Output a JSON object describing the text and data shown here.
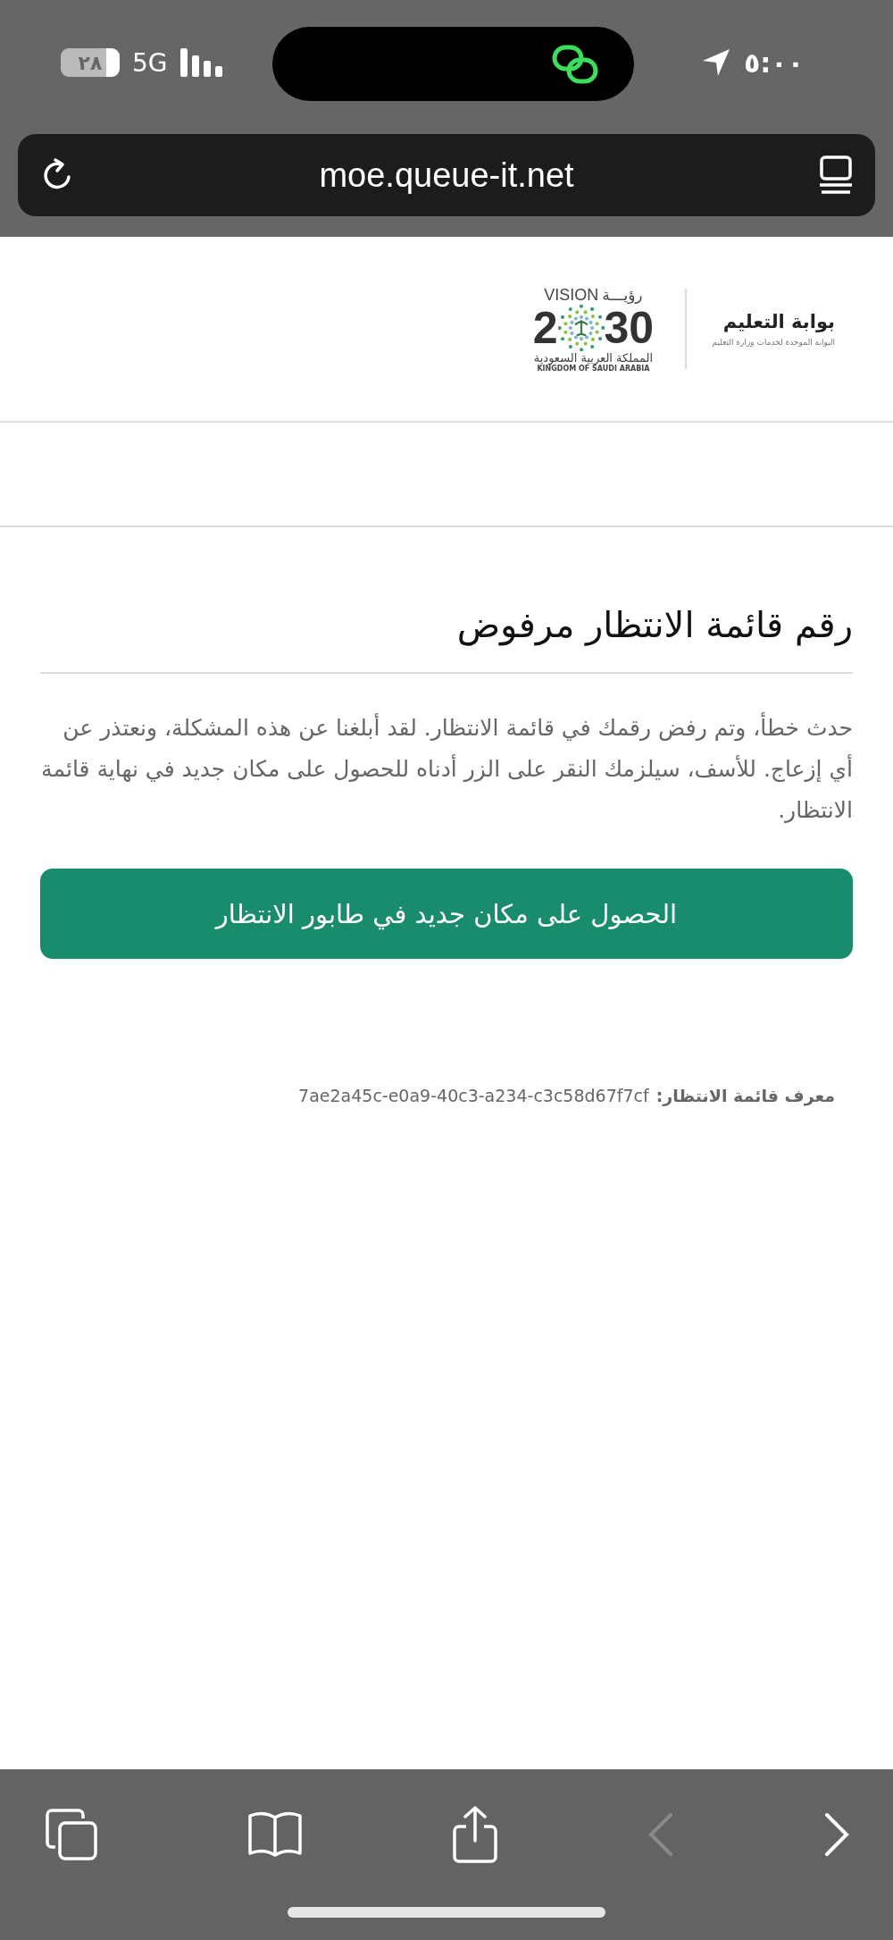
{
  "status_bar": {
    "battery": "٢٨",
    "network": "5G",
    "time": "٥:٠٠"
  },
  "address_bar": {
    "url": "moe.queue-it.net"
  },
  "header": {
    "vision_logo": {
      "arabic_word": "رؤيـــة",
      "english_word": "VISION",
      "year_start": "2",
      "year_end": "30",
      "country_arabic": "المملكة العربية السعودية",
      "country_english": "KINGDOM OF SAUDI ARABIA"
    },
    "portal_logo": {
      "title": "بوابة التعليم",
      "subtitle": "البوابة الموحدة لخدمات وزارة التعليم"
    }
  },
  "content": {
    "title": "رقم قائمة الانتظار مرفوض",
    "message": "حدث خطأ، وتم رفض رقمك في قائمة الانتظار. لقد أبلغنا عن هذه المشكلة، ونعتذر عن أي إزعاج. للأسف، سيلزمك النقر على الزر أدناه للحصول على مكان جديد في نهاية قائمة الانتظار.",
    "button": "الحصول على مكان جديد في طابور الانتظار",
    "queue_id_label": "معرف قائمة الانتظار:",
    "queue_id": "7ae2a45c-e0a9-40c3-a234-c3c58d67f7cf"
  },
  "toolbar": {
    "back_disabled": true,
    "forward_disabled": false
  }
}
